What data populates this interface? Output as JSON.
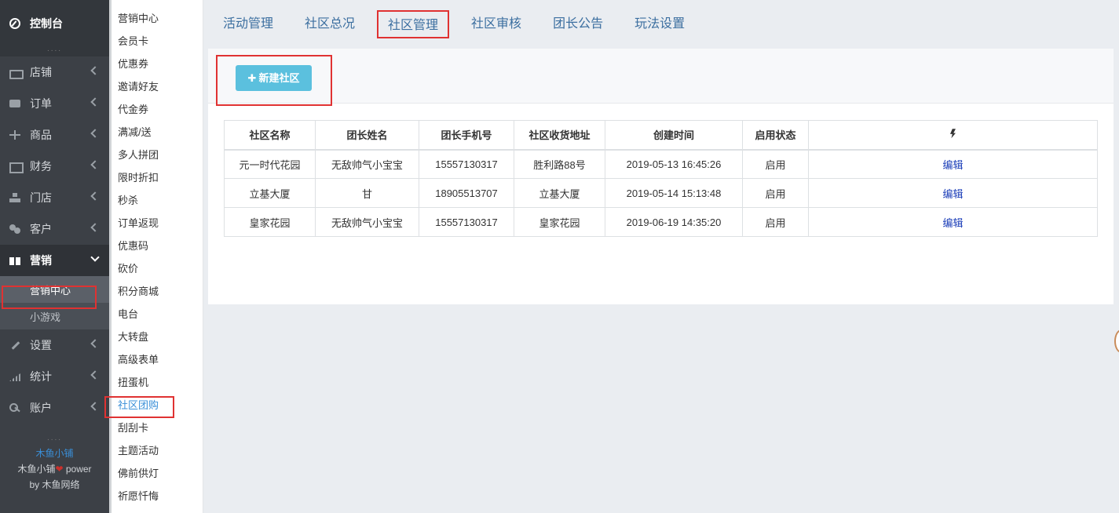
{
  "sidebar": {
    "dashboard_label": "控制台",
    "dots": "....",
    "items": [
      {
        "label": "店铺",
        "icon": "shop-icon"
      },
      {
        "label": "订单",
        "icon": "order-icon"
      },
      {
        "label": "商品",
        "icon": "scale-icon"
      },
      {
        "label": "财务",
        "icon": "finance-icon"
      },
      {
        "label": "门店",
        "icon": "store-icon"
      },
      {
        "label": "客户",
        "icon": "users-icon"
      },
      {
        "label": "营销",
        "icon": "gift-icon"
      },
      {
        "label": "设置",
        "icon": "wrench-icon"
      },
      {
        "label": "统计",
        "icon": "stats-icon"
      },
      {
        "label": "账户",
        "icon": "key-icon"
      }
    ],
    "marketing_sub": [
      "营销中心",
      "小游戏"
    ],
    "footer": {
      "brand": "木鱼小铺",
      "power_prefix": "木鱼小铺",
      "power_suffix": "power",
      "by_label": "by 木鱼网络"
    }
  },
  "subnav": {
    "items": [
      "营销中心",
      "会员卡",
      "优惠券",
      "邀请好友",
      "代金券",
      "满减/送",
      "多人拼团",
      "限时折扣",
      "秒杀",
      "订单返现",
      "优惠码",
      "砍价",
      "积分商城",
      "电台",
      "大转盘",
      "高级表单",
      "扭蛋机",
      "社区团购",
      "刮刮卡",
      "主题活动",
      "佛前供灯",
      "祈愿忏悔"
    ],
    "active": "社区团购"
  },
  "tabs": [
    "活动管理",
    "社区总况",
    "社区管理",
    "社区审核",
    "团长公告",
    "玩法设置"
  ],
  "active_tab": "社区管理",
  "toolbar": {
    "new_button": "新建社区"
  },
  "table": {
    "headers": [
      "社区名称",
      "团长姓名",
      "团长手机号",
      "社区收货地址",
      "创建时间",
      "启用状态"
    ],
    "action_header_icon": "bolt-icon",
    "rows": [
      {
        "name": "元一时代花园",
        "leader": "无敌帅气小宝宝",
        "phone": "15557130317",
        "address": "胜利路88号",
        "created": "2019-05-13 16:45:26",
        "status": "启用",
        "action": "编辑"
      },
      {
        "name": "立基大厦",
        "leader": "甘",
        "phone": "18905513707",
        "address": "立基大厦",
        "created": "2019-05-14 15:13:48",
        "status": "启用",
        "action": "编辑"
      },
      {
        "name": "皇家花园",
        "leader": "无敌帅气小宝宝",
        "phone": "15557130317",
        "address": "皇家花园",
        "created": "2019-06-19 14:35:20",
        "status": "启用",
        "action": "编辑"
      }
    ]
  },
  "colors": {
    "sidebar_bg": "#3c4046",
    "accent": "#5bc0de",
    "highlight_border": "#e03232",
    "link": "#1a3db8"
  }
}
